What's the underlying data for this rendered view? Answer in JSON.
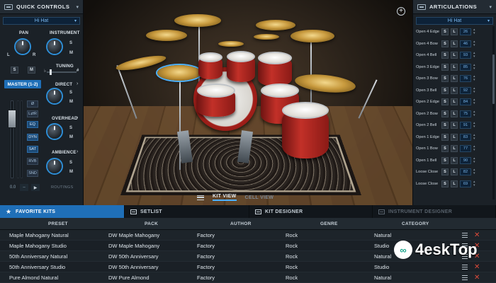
{
  "quick_controls": {
    "title": "QUICK CONTROLS",
    "selected_instrument": "Hi Hat",
    "pan_label": "PAN",
    "pan_l": "L",
    "pan_r": "R",
    "instrument_label": "INSTRUMENT",
    "s": "S",
    "m": "M",
    "tuning_label": "TUNING",
    "master_label": "MASTER (1-2)",
    "direct_label": "DIRECT",
    "overhead_label": "OVERHEAD",
    "ambience_label": "AMBIENCE",
    "fx_buttons": [
      "Ø",
      "L⇄R",
      "EQ",
      "DYN",
      "SAT",
      "RVB",
      "SND"
    ],
    "volume": "0.0",
    "routings_label": "ROUTINGS"
  },
  "stage": {
    "kick_logo": "dw",
    "view_tabs": [
      "KIT VIEW",
      "CELL VIEW"
    ]
  },
  "articulations": {
    "title": "ARTICULATIONS",
    "selected": "Hi Hat",
    "rows": [
      {
        "name": "Open 4 Edge",
        "value": "26"
      },
      {
        "name": "Open 4 Bow",
        "value": "46"
      },
      {
        "name": "Open 4 Bell",
        "value": "93"
      },
      {
        "name": "Open 3 Edge",
        "value": "85"
      },
      {
        "name": "Open 3 Bow",
        "value": "76"
      },
      {
        "name": "Open 3 Bell",
        "value": "92"
      },
      {
        "name": "Open 2 Edge",
        "value": "84"
      },
      {
        "name": "Open 2 Bow",
        "value": "75"
      },
      {
        "name": "Open 2 Bell",
        "value": "91"
      },
      {
        "name": "Open 1 Edge",
        "value": "83"
      },
      {
        "name": "Open 1 Bow",
        "value": "77"
      },
      {
        "name": "Open 1 Bell",
        "value": "90"
      },
      {
        "name": "Loose Close",
        "value": "82"
      },
      {
        "name": "Loose Close",
        "value": "69"
      }
    ],
    "s": "S",
    "l": "L"
  },
  "browser": {
    "tabs": [
      "FAVORITE KITS",
      "SETLIST",
      "KIT DESIGNER",
      "INSTRUMENT DESIGNER"
    ],
    "columns": [
      "PRESET",
      "PACK",
      "AUTHOR",
      "GENRE",
      "CATEGORY"
    ],
    "rows": [
      [
        "Maple Mahogany Natural",
        "DW Maple Mahogany",
        "Factory",
        "Rock",
        "Natural"
      ],
      [
        "Maple Mahogany Studio",
        "DW Maple Mahogany",
        "Factory",
        "Rock",
        "Studio"
      ],
      [
        "50th Anniversary Natural",
        "DW 50th Anniversary",
        "Factory",
        "Rock",
        "Natural"
      ],
      [
        "50th Anniversary Studio",
        "DW 50th Anniversary",
        "Factory",
        "Rock",
        "Studio"
      ],
      [
        "Pure Almond Natural",
        "DW Pure Almond",
        "Factory",
        "Rock",
        "Natural"
      ]
    ]
  },
  "watermark": {
    "text": "4eskTop",
    "mark": "∞"
  },
  "colors": {
    "accent": "#1f6fb8",
    "highlight": "#4db2ff",
    "delete": "#e04a3a"
  }
}
